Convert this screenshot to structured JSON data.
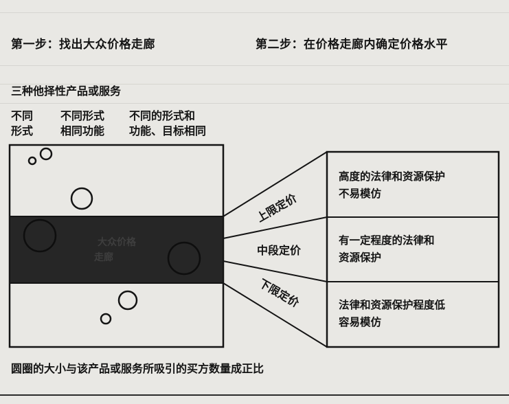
{
  "step1": "第一步：找出大众价格走廊",
  "step2": "第二步：在价格走廊内确定价格水平",
  "alternatives_title": "三种他择性产品或服务",
  "columns": [
    {
      "line1": "不同",
      "line2": "形式"
    },
    {
      "line1": "不同形式",
      "line2": "相同功能"
    },
    {
      "line1": "不同的形式和",
      "line2": "功能、目标相同"
    }
  ],
  "corridor_label_line1": "大众价格",
  "corridor_label_line2": "走廊",
  "price_levels": {
    "upper": "上限定价",
    "middle": "中段定价",
    "lower": "下限定价"
  },
  "descriptions": [
    {
      "line1": "高度的法律和资源保护",
      "line2": "不易模仿"
    },
    {
      "line1": "有一定程度的法律和",
      "line2": "资源保护"
    },
    {
      "line1": "法律和资源保护程度低",
      "line2": "容易模仿"
    }
  ],
  "footnote": "圆圈的大小与该产品或服务所吸引的买方数量成正比",
  "colors": {
    "ink": "#141414",
    "paper": "#e9e8e4",
    "corridor": "#262626"
  }
}
